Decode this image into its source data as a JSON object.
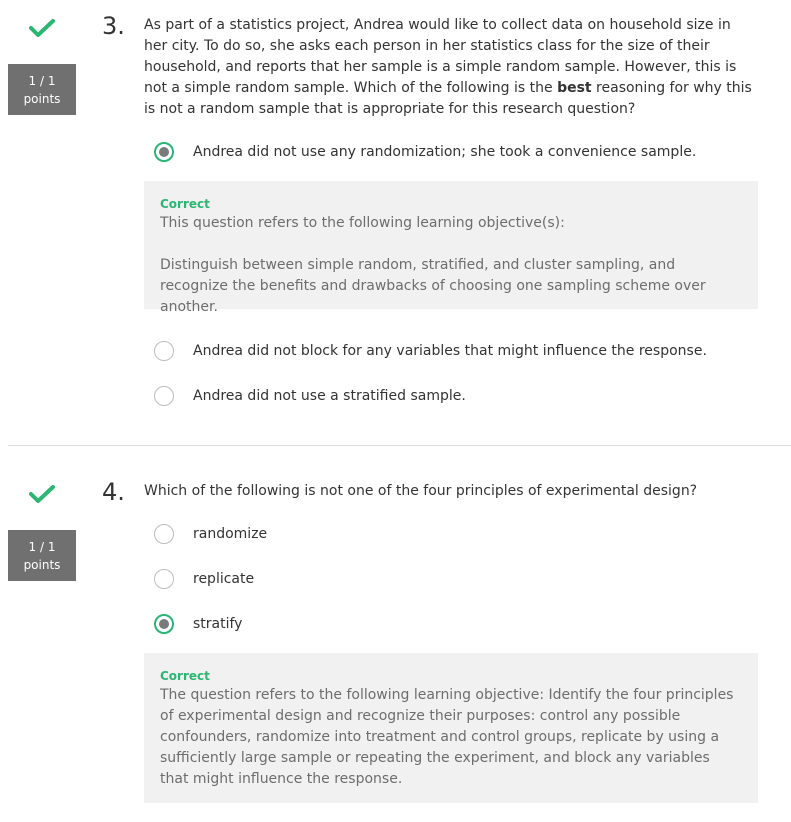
{
  "questions": [
    {
      "number": "3.",
      "score": "1 / 1",
      "points_label": "points",
      "text_before": "As part of a statistics project, Andrea would like to collect data on household size in her city. To do so, she asks each person in her statistics class for the size of their household, and reports that her sample is a simple random sample. However, this is not a simple random sample. Which of the following is the ",
      "text_bold": "best",
      "text_after": " reasoning for why this is not a random sample that is appropriate for this research question?",
      "options": [
        "Andrea did not use any randomization; she took a convenience sample.",
        "Andrea did not block for any variables that might influence the response.",
        "Andrea did not use a stratified sample."
      ],
      "feedback": {
        "status": "Correct",
        "line1": "This question refers to the following learning objective(s):",
        "line2": "Distinguish between simple random, stratified, and cluster sampling, and recognize the benefits and drawbacks of choosing one sampling scheme over another."
      }
    },
    {
      "number": "4.",
      "score": "1 / 1",
      "points_label": "points",
      "text": "Which of the following is not one of the four principles of experimental design?",
      "options": [
        "randomize",
        "replicate",
        "stratify"
      ],
      "feedback": {
        "status": "Correct",
        "line1": "The question refers to the following learning objective: Identify the four principles of experimental design and recognize their purposes: control any possible confounders, randomize into treatment and control groups, replicate by using a sufficiently large sample or repeating the experiment, and block any variables that might influence the response."
      }
    }
  ]
}
